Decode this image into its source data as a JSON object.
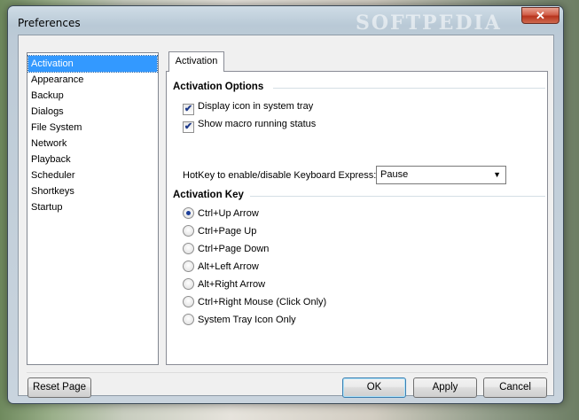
{
  "window": {
    "title": "Preferences",
    "watermark": "SOFTPEDIA",
    "close_glyph": "✕"
  },
  "sidebar": {
    "items": [
      {
        "label": "Activation",
        "selected": true
      },
      {
        "label": "Appearance"
      },
      {
        "label": "Backup"
      },
      {
        "label": "Dialogs"
      },
      {
        "label": "File System"
      },
      {
        "label": "Network"
      },
      {
        "label": "Playback"
      },
      {
        "label": "Scheduler"
      },
      {
        "label": "Shortkeys"
      },
      {
        "label": "Startup"
      }
    ]
  },
  "tab": {
    "label": "Activation"
  },
  "activation_options": {
    "title": "Activation Options",
    "display_icon": {
      "label": "Display icon in system tray",
      "checked": true
    },
    "show_macro": {
      "label": "Show macro running status",
      "checked": true
    },
    "hotkey_label": "HotKey to enable/disable Keyboard Express:",
    "hotkey_value": "Pause"
  },
  "activation_key": {
    "title": "Activation Key",
    "options": [
      {
        "label": "Ctrl+Up Arrow",
        "selected": true
      },
      {
        "label": "Ctrl+Page Up"
      },
      {
        "label": "Ctrl+Page Down"
      },
      {
        "label": "Alt+Left Arrow"
      },
      {
        "label": "Alt+Right Arrow"
      },
      {
        "label": "Ctrl+Right Mouse (Click Only)"
      },
      {
        "label": "System Tray Icon Only"
      }
    ]
  },
  "buttons": {
    "reset": "Reset Page",
    "ok": "OK",
    "apply": "Apply",
    "cancel": "Cancel"
  },
  "check_glyph": "✔",
  "colors": {
    "selection": "#3399ff",
    "close_button": "#c4432b"
  }
}
